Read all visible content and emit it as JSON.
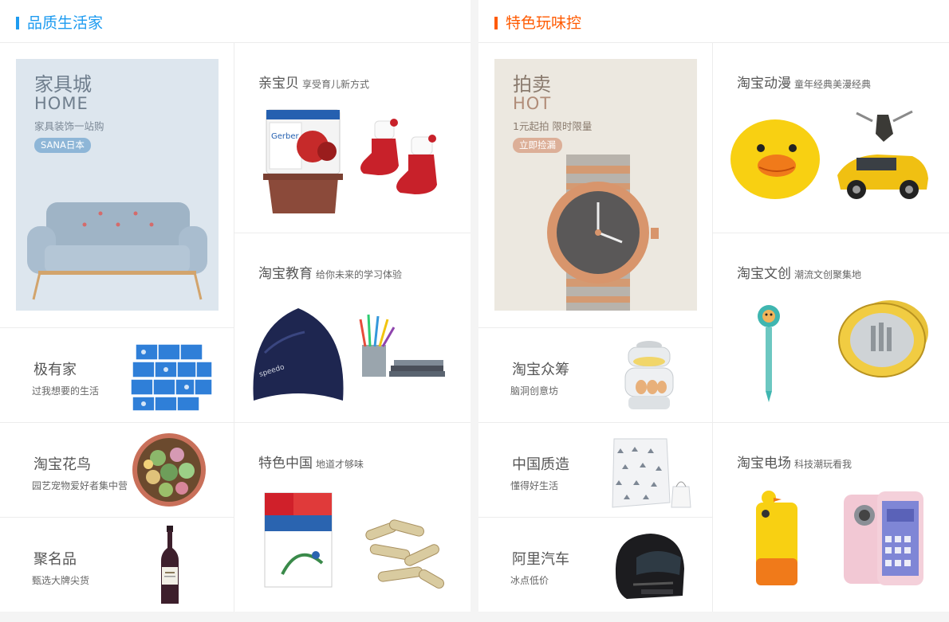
{
  "left": {
    "title": "品质生活家",
    "accent": "#1d9bf0",
    "promo": {
      "title": "家具城",
      "eng": "HOME",
      "sub": "家具装饰一站购",
      "badge": "SANA日本"
    },
    "cells": [
      {
        "title": "极有家",
        "sub": "过我想要的生活",
        "image": "tissue-packs-image"
      },
      {
        "title": "淘宝花鸟",
        "sub": "园艺宠物爱好者集中营",
        "image": "succulent-planter-image"
      },
      {
        "title": "聚名品",
        "sub": "甄选大牌尖货",
        "image": "wine-bottle-image"
      }
    ],
    "features": [
      {
        "title": "亲宝贝",
        "sub": "享受育儿新方式",
        "image_a": "baby-food-jars-image",
        "image_b": "baby-shoes-image"
      },
      {
        "title": "淘宝教育",
        "sub": "给你未来的学习体验",
        "image_a": "swim-cap-image",
        "image_b": "pencil-cup-books-image"
      },
      {
        "title": "特色中国",
        "sub": "地道才够味",
        "image_a": "supplement-box-image",
        "image_b": "dried-herbs-image"
      }
    ]
  },
  "right": {
    "title": "特色玩味控",
    "accent": "#ff5a00",
    "promo": {
      "title": "拍卖",
      "eng": "HOT",
      "sub": "1元起拍  限时限量",
      "badge": "立即捡漏"
    },
    "cells": [
      {
        "title": "淘宝众筹",
        "sub": "脑洞创意坊",
        "image": "egg-steamer-image"
      },
      {
        "title": "中国质造",
        "sub": "懂得好生活",
        "image": "bedding-set-image"
      },
      {
        "title": "阿里汽车",
        "sub": "冰点低价",
        "image": "motorcycle-helmet-image"
      }
    ],
    "features": [
      {
        "title": "淘宝动漫",
        "sub": "童年经典美漫经典",
        "image_a": "duck-coin-purse-image",
        "image_b": "toy-car-robot-image"
      },
      {
        "title": "淘宝文创",
        "sub": "潮流文创聚集地",
        "image_a": "lion-pen-image",
        "image_b": "commemorative-coins-image"
      },
      {
        "title": "淘宝电场",
        "sub": "科技潮玩看我",
        "image_a": "duck-phone-case-image",
        "image_b": "pink-smartphone-image"
      }
    ]
  }
}
